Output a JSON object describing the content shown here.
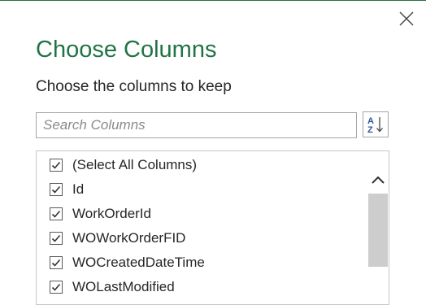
{
  "dialog": {
    "title": "Choose Columns",
    "subtitle": "Choose the columns to keep",
    "close_icon": "close-icon",
    "accent_color": "#217346"
  },
  "search": {
    "placeholder": "Search Columns",
    "value": ""
  },
  "sort": {
    "icon": "sort-az-icon",
    "icon_letters_top": "A",
    "icon_letters_bottom": "Z"
  },
  "columns": [
    {
      "label": "(Select All Columns)",
      "checked": true
    },
    {
      "label": "Id",
      "checked": true
    },
    {
      "label": "WorkOrderId",
      "checked": true
    },
    {
      "label": "WOWorkOrderFID",
      "checked": true
    },
    {
      "label": "WOCreatedDateTime",
      "checked": true
    },
    {
      "label": "WOLastModified",
      "checked": true
    }
  ]
}
